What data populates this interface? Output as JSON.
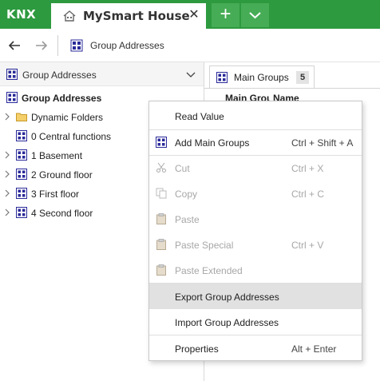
{
  "app": {
    "logo": "KNX",
    "tab_title": "MySmart House",
    "tab_close": "✕",
    "add_button": "+",
    "accent": "#2d9a3f"
  },
  "nav": {
    "breadcrumb": "Group Addresses"
  },
  "left_pane": {
    "header": "Group Addresses",
    "tree": [
      {
        "label": "Group Addresses",
        "icon": "group-address-icon"
      },
      {
        "label": "Dynamic Folders",
        "icon": "folder-icon"
      },
      {
        "label": "0 Central functions",
        "icon": "group-address-icon"
      },
      {
        "label": "1 Basement",
        "icon": "group-address-icon"
      },
      {
        "label": "2 Ground floor",
        "icon": "group-address-icon"
      },
      {
        "label": "3 First floor",
        "icon": "group-address-icon"
      },
      {
        "label": "4 Second floor",
        "icon": "group-address-icon"
      }
    ]
  },
  "right_pane": {
    "tab_label": "Main Groups",
    "tab_count": "5",
    "columns": [
      "Main Group",
      "Name"
    ]
  },
  "context_menu": {
    "items": [
      {
        "label": "Read Value",
        "shortcut": "",
        "icon": "",
        "disabled": false
      },
      {
        "label": "Add Main Groups",
        "shortcut": "Ctrl + Shift + A",
        "icon": "group-address-icon",
        "disabled": false
      },
      {
        "label": "Cut",
        "shortcut": "Ctrl + X",
        "icon": "scissors-icon",
        "disabled": true
      },
      {
        "label": "Copy",
        "shortcut": "Ctrl + C",
        "icon": "copy-icon",
        "disabled": true
      },
      {
        "label": "Paste",
        "shortcut": "",
        "icon": "clipboard-icon",
        "disabled": true
      },
      {
        "label": "Paste Special",
        "shortcut": "Ctrl + V",
        "icon": "clipboard-icon",
        "disabled": true
      },
      {
        "label": "Paste Extended",
        "shortcut": "",
        "icon": "clipboard-icon",
        "disabled": true
      },
      {
        "label": "Export Group Addresses",
        "shortcut": "",
        "icon": "",
        "disabled": false,
        "highlighted": true
      },
      {
        "label": "Import Group Addresses",
        "shortcut": "",
        "icon": "",
        "disabled": false
      },
      {
        "label": "Properties",
        "shortcut": "Alt + Enter",
        "icon": "",
        "disabled": false
      }
    ]
  }
}
